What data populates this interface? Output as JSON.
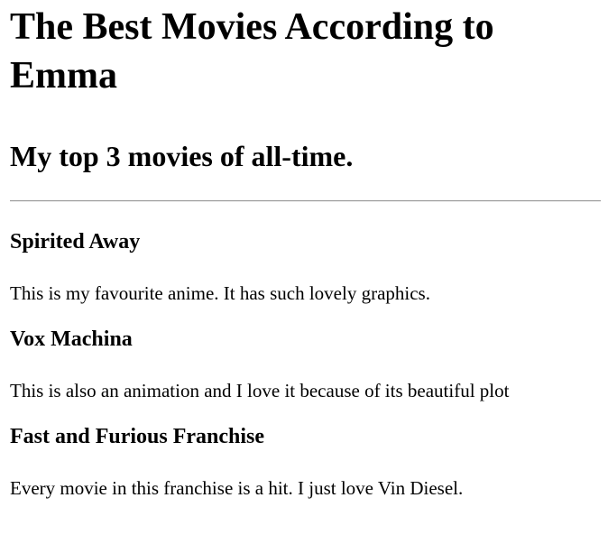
{
  "page": {
    "title": "The Best Movies According to Emma",
    "subtitle": "My top 3 movies of all-time."
  },
  "movies": [
    {
      "title": "Spirited Away",
      "description": "This is my favourite anime. It has such lovely graphics."
    },
    {
      "title": "Vox Machina",
      "description": "This is also an animation and I love it because of its beautiful plot"
    },
    {
      "title": "Fast and Furious Franchise",
      "description": "Every movie in this franchise is a hit. I just love Vin Diesel."
    }
  ]
}
